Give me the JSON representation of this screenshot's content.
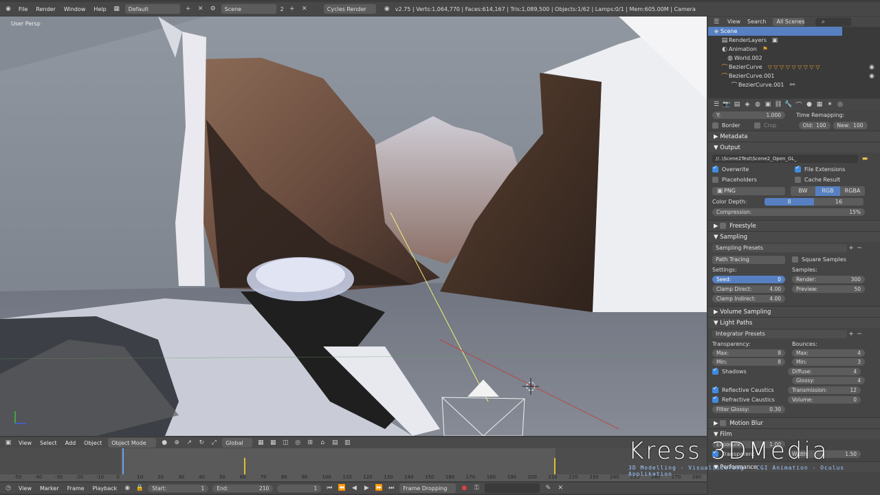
{
  "topbar": {
    "menus": [
      "File",
      "Render",
      "Window",
      "Help"
    ],
    "layout": "Default",
    "scene": "Scene",
    "scene_num": "2",
    "engine": "Cycles Render",
    "stats": "v2.75 | Verts:1,064,770 | Faces:614,167 | Tris:1,089,500 | Objects:1/62 | Lamps:0/1 | Mem:605.00M | Camera"
  },
  "viewport": {
    "label": "User Persp"
  },
  "header3d": {
    "menus": [
      "View",
      "Select",
      "Add",
      "Object"
    ],
    "mode": "Object Mode",
    "orientation": "Global"
  },
  "outliner": {
    "tabs": [
      "View",
      "Search",
      "All Scenes"
    ],
    "items": [
      "Scene",
      "RenderLayers",
      "Animation",
      "World.002",
      "BezierCurve",
      "BezierCurve.001",
      "BezierCurve.001"
    ]
  },
  "props": {
    "top": {
      "y_label": "Y:",
      "y_val": "1.000",
      "time_remap": "Time Remapping:",
      "border": "Border",
      "crop": "Crop",
      "old": "Old:",
      "old_val": "100",
      "new": "New:",
      "new_val": "100"
    },
    "metadata": "Metadata",
    "output": {
      "title": "Output",
      "path": "//..\\Scene2Test\\Scene2_Open_GL_",
      "overwrite": "Overwrite",
      "file_ext": "File Extensions",
      "placeholders": "Placeholders",
      "cache": "Cache Result",
      "format": "PNG",
      "bw": "BW",
      "rgb": "RGB",
      "rgba": "RGBA",
      "color_depth": "Color Depth:",
      "d8": "8",
      "d16": "16",
      "compression": "Compression:",
      "compression_val": "15%"
    },
    "freestyle": "Freestyle",
    "sampling": {
      "title": "Sampling",
      "presets": "Sampling Presets",
      "method": "Path Tracing",
      "square": "Square Samples",
      "settings": "Settings:",
      "samples": "Samples:",
      "seed": "Seed:",
      "seed_val": "0",
      "render": "Render:",
      "render_val": "300",
      "clamp_direct": "Clamp Direct:",
      "clamp_direct_val": "4.00",
      "preview": "Preview:",
      "preview_val": "50",
      "clamp_indirect": "Clamp Indirect:",
      "clamp_indirect_val": "4.00"
    },
    "volume": "Volume Sampling",
    "light": {
      "title": "Light Paths",
      "presets": "Integrator Presets",
      "transparency": "Transparency:",
      "bounces": "Bounces:",
      "t_max": "Max:",
      "t_max_val": "8",
      "t_min": "Min:",
      "t_min_val": "8",
      "b_max": "Max:",
      "b_max_val": "4",
      "b_min": "Min:",
      "b_min_val": "3",
      "shadows": "Shadows",
      "diffuse": "Diffuse:",
      "diffuse_val": "4",
      "glossy": "Glossy:",
      "glossy_val": "4",
      "refl": "Reflective Caustics",
      "transmission": "Transmission:",
      "transmission_val": "12",
      "refr": "Refractive Caustics",
      "volume": "Volume:",
      "volume_val": "0",
      "filter": "Filter Glossy:",
      "filter_val": "0.30"
    },
    "motion_blur": "Motion Blur",
    "film": {
      "title": "Film",
      "exposure": "Exposure:",
      "exposure_val": "1.00",
      "transparent": "Transparent",
      "width": "Width:",
      "width_val": "1.50"
    },
    "performance": "Performance"
  },
  "timeline": {
    "ticks": [
      "-50",
      "-40",
      "-30",
      "-20",
      "-10",
      "0",
      "10",
      "20",
      "30",
      "40",
      "50",
      "60",
      "70",
      "80",
      "90",
      "100",
      "110",
      "120",
      "130",
      "140",
      "150",
      "160",
      "170",
      "180",
      "190",
      "200",
      "210",
      "220",
      "230",
      "240",
      "250",
      "260",
      "270",
      "280"
    ]
  },
  "bottombar": {
    "menus": [
      "View",
      "Marker",
      "Frame",
      "Playback"
    ],
    "start": "Start:",
    "start_val": "1",
    "end": "End:",
    "end_val": "210",
    "current": "1",
    "sync": "Frame Dropping"
  },
  "watermark": {
    "brand": "Kress 3DMedia",
    "tagline": "3D Modelling - Visualisierung - CGI Animation - Oculus Applikation"
  }
}
